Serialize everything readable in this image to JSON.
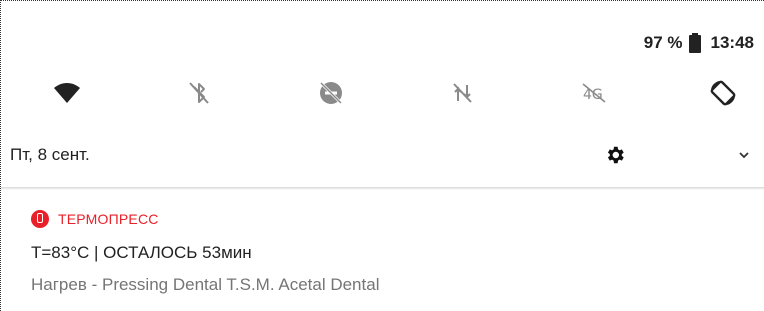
{
  "status_bar": {
    "battery_percent": "97 %",
    "battery_icon": "battery-full-icon",
    "time": "13:48"
  },
  "quick_settings": [
    {
      "name": "wifi",
      "icon": "wifi-icon",
      "state": "on"
    },
    {
      "name": "bluetooth",
      "icon": "bluetooth-off-icon",
      "state": "off"
    },
    {
      "name": "do-not-disturb",
      "icon": "do-not-disturb-off-icon",
      "state": "off"
    },
    {
      "name": "mobile-data",
      "icon": "mobile-data-off-icon",
      "state": "off"
    },
    {
      "name": "4g",
      "icon": "4g-off-icon",
      "state": "off"
    },
    {
      "name": "auto-rotate",
      "icon": "auto-rotate-icon",
      "state": "on"
    }
  ],
  "date_row": {
    "date": "Пт, 8 сент.",
    "settings_icon": "gear-icon",
    "expand_icon": "chevron-down-icon"
  },
  "notification": {
    "app_name": "ТЕРМОПРЕСС",
    "title": "T=83°C | ОСТАЛОСЬ 53мин",
    "text": "Нагрев - Pressing Dental T.S.M. Acetal Dental",
    "accent_color": "#e8202a"
  },
  "colors": {
    "icon_active": "#222222",
    "icon_inactive": "#8a8a8a",
    "text_primary": "#222222",
    "text_secondary": "#757575"
  }
}
